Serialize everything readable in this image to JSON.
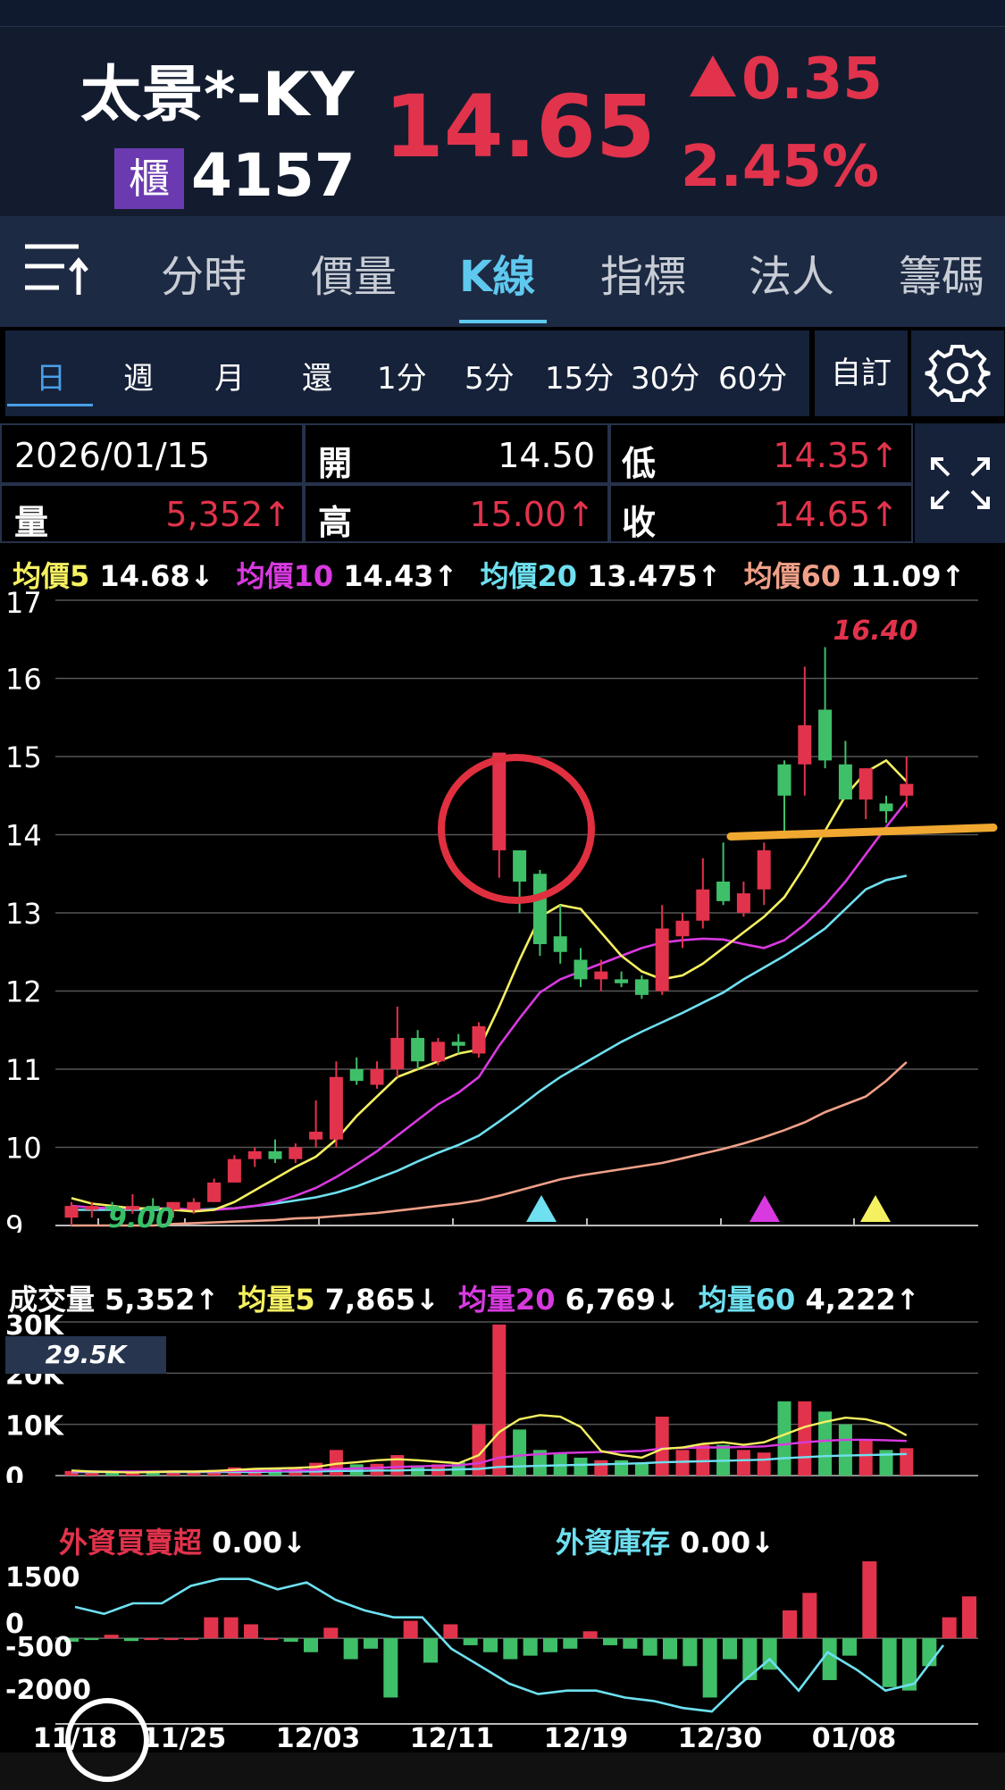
{
  "header": {
    "stock_name": "太景*-KY",
    "market_badge": "櫃",
    "stock_code": "4157",
    "price": "14.65",
    "change": "0.35",
    "change_pct": "2.45%"
  },
  "tabs": [
    {
      "label": "分時"
    },
    {
      "label": "價量"
    },
    {
      "label": "K線"
    },
    {
      "label": "指標"
    },
    {
      "label": "法人"
    },
    {
      "label": "籌碼"
    }
  ],
  "periods": [
    "日",
    "週",
    "月",
    "還",
    "1分",
    "5分",
    "15分",
    "30分",
    "60分"
  ],
  "custom_label": "自訂",
  "quote": {
    "date": "2026/01/15",
    "open_label": "開",
    "open": "14.50",
    "low_label": "低",
    "low": "14.35↑",
    "vol_label": "量",
    "vol": "5,352↑",
    "high_label": "高",
    "high": "15.00↑",
    "close_label": "收",
    "close": "14.65↑"
  },
  "ma_legend": {
    "ma5_label": "均價5",
    "ma5": "14.68↓",
    "ma10_label": "均價10",
    "ma10": "14.43↑",
    "ma20_label": "均價20",
    "ma20": "13.475↑",
    "ma60_label": "均價60",
    "ma60": "11.09↑"
  },
  "vol_legend": {
    "vol_label": "成交量",
    "vol": "5,352↑",
    "mv5_label": "均量5",
    "mv5": "7,865↓",
    "mv20_label": "均量20",
    "mv20": "6,769↓",
    "mv60_label": "均量60",
    "mv60": "4,222↑"
  },
  "vol_max_label": "29.5K",
  "inst_legend": {
    "foreign_label": "外資買賣超",
    "foreign": "0.00↓",
    "holding_label": "外資庫存",
    "holding": "0.00↓"
  },
  "colors": {
    "up": "#e2334c",
    "down": "#3fbf68",
    "ma5": "#f5f060",
    "ma10": "#d83ae0",
    "ma20": "#6ee0f0",
    "ma60": "#f0a088",
    "support_line": "#f0a830",
    "circle": "#e03040"
  },
  "chart_data": {
    "type": "candlestick",
    "price_axis": {
      "ticks": [
        "17",
        "16",
        "15",
        "14",
        "13",
        "12",
        "11",
        "10",
        "9"
      ],
      "ylim": [
        9,
        17
      ]
    },
    "x_ticks": [
      "11/18",
      "11/25",
      "12/03",
      "12/11",
      "12/19",
      "12/30",
      "01/08"
    ],
    "max_label": "16.40",
    "min_label": "9.00",
    "support_level": 14.0,
    "candles": [
      {
        "o": 9.1,
        "h": 9.3,
        "l": 9.0,
        "c": 9.25
      },
      {
        "o": 9.2,
        "h": 9.3,
        "l": 9.1,
        "c": 9.25
      },
      {
        "o": 9.25,
        "h": 9.3,
        "l": 9.15,
        "c": 9.2
      },
      {
        "o": 9.2,
        "h": 9.4,
        "l": 9.15,
        "c": 9.25
      },
      {
        "o": 9.25,
        "h": 9.35,
        "l": 9.15,
        "c": 9.2
      },
      {
        "o": 9.2,
        "h": 9.3,
        "l": 9.1,
        "c": 9.3
      },
      {
        "o": 9.2,
        "h": 9.35,
        "l": 9.15,
        "c": 9.3
      },
      {
        "o": 9.3,
        "h": 9.6,
        "l": 9.3,
        "c": 9.55
      },
      {
        "o": 9.55,
        "h": 9.9,
        "l": 9.55,
        "c": 9.85
      },
      {
        "o": 9.85,
        "h": 10.0,
        "l": 9.75,
        "c": 9.95
      },
      {
        "o": 9.95,
        "h": 10.1,
        "l": 9.8,
        "c": 9.85
      },
      {
        "o": 9.85,
        "h": 10.05,
        "l": 9.8,
        "c": 10.0
      },
      {
        "o": 10.1,
        "h": 10.6,
        "l": 10.0,
        "c": 10.2
      },
      {
        "o": 10.1,
        "h": 11.1,
        "l": 10.0,
        "c": 10.9
      },
      {
        "o": 11.0,
        "h": 11.15,
        "l": 10.8,
        "c": 10.85
      },
      {
        "o": 10.8,
        "h": 11.1,
        "l": 10.75,
        "c": 11.0
      },
      {
        "o": 11.0,
        "h": 11.8,
        "l": 10.9,
        "c": 11.4
      },
      {
        "o": 11.4,
        "h": 11.5,
        "l": 11.0,
        "c": 11.1
      },
      {
        "o": 11.1,
        "h": 11.4,
        "l": 11.05,
        "c": 11.35
      },
      {
        "o": 11.35,
        "h": 11.45,
        "l": 11.2,
        "c": 11.3
      },
      {
        "o": 11.2,
        "h": 11.6,
        "l": 11.15,
        "c": 11.55
      },
      {
        "o": 13.8,
        "h": 15.05,
        "l": 13.45,
        "c": 15.05
      },
      {
        "o": 13.8,
        "h": 13.8,
        "l": 13.0,
        "c": 13.4
      },
      {
        "o": 13.5,
        "h": 13.55,
        "l": 12.45,
        "c": 12.6
      },
      {
        "o": 12.7,
        "h": 13.1,
        "l": 12.35,
        "c": 12.5
      },
      {
        "o": 12.4,
        "h": 12.55,
        "l": 12.05,
        "c": 12.15
      },
      {
        "o": 12.15,
        "h": 12.4,
        "l": 12.0,
        "c": 12.25
      },
      {
        "o": 12.15,
        "h": 12.25,
        "l": 12.05,
        "c": 12.1
      },
      {
        "o": 12.15,
        "h": 12.2,
        "l": 11.9,
        "c": 11.95
      },
      {
        "o": 12.0,
        "h": 13.1,
        "l": 11.95,
        "c": 12.8
      },
      {
        "o": 12.7,
        "h": 13.0,
        "l": 12.55,
        "c": 12.9
      },
      {
        "o": 12.9,
        "h": 13.7,
        "l": 12.8,
        "c": 13.3
      },
      {
        "o": 13.4,
        "h": 13.9,
        "l": 13.1,
        "c": 13.15
      },
      {
        "o": 13.0,
        "h": 13.4,
        "l": 12.95,
        "c": 13.25
      },
      {
        "o": 13.3,
        "h": 13.9,
        "l": 13.1,
        "c": 13.8
      },
      {
        "o": 14.9,
        "h": 14.95,
        "l": 13.95,
        "c": 14.5
      },
      {
        "o": 14.9,
        "h": 16.15,
        "l": 14.5,
        "c": 15.4
      },
      {
        "o": 15.6,
        "h": 16.4,
        "l": 14.85,
        "c": 14.95
      },
      {
        "o": 14.9,
        "h": 15.2,
        "l": 14.55,
        "c": 14.45
      },
      {
        "o": 14.45,
        "h": 14.85,
        "l": 14.2,
        "c": 14.85
      },
      {
        "o": 14.4,
        "h": 14.5,
        "l": 14.15,
        "c": 14.3
      },
      {
        "o": 14.5,
        "h": 15.0,
        "l": 14.35,
        "c": 14.65
      }
    ],
    "ma5": [
      9.35,
      9.28,
      9.25,
      9.22,
      9.22,
      9.2,
      9.18,
      9.2,
      9.3,
      9.45,
      9.6,
      9.75,
      9.88,
      10.1,
      10.4,
      10.65,
      10.9,
      11.0,
      11.1,
      11.2,
      11.25,
      11.8,
      12.4,
      12.95,
      13.1,
      13.05,
      12.75,
      12.45,
      12.25,
      12.15,
      12.2,
      12.35,
      12.55,
      12.75,
      12.95,
      13.2,
      13.6,
      14.05,
      14.5,
      14.8,
      14.95,
      14.68
    ],
    "ma10": [
      9.25,
      9.23,
      9.22,
      9.22,
      9.22,
      9.22,
      9.2,
      9.2,
      9.22,
      9.25,
      9.3,
      9.38,
      9.48,
      9.62,
      9.78,
      9.95,
      10.15,
      10.35,
      10.55,
      10.7,
      10.9,
      11.3,
      11.65,
      11.98,
      12.15,
      12.25,
      12.35,
      12.45,
      12.55,
      12.62,
      12.65,
      12.67,
      12.66,
      12.6,
      12.55,
      12.65,
      12.85,
      13.1,
      13.4,
      13.75,
      14.1,
      14.43
    ],
    "ma20": [
      9.2,
      9.2,
      9.2,
      9.2,
      9.2,
      9.2,
      9.2,
      9.21,
      9.22,
      9.25,
      9.28,
      9.32,
      9.36,
      9.42,
      9.5,
      9.6,
      9.7,
      9.82,
      9.93,
      10.03,
      10.15,
      10.33,
      10.52,
      10.72,
      10.9,
      11.05,
      11.2,
      11.35,
      11.48,
      11.6,
      11.72,
      11.85,
      11.98,
      12.15,
      12.3,
      12.45,
      12.62,
      12.8,
      13.05,
      13.3,
      13.42,
      13.475
    ],
    "ma60": [
      9.0,
      9.0,
      9.0,
      9.0,
      9.0,
      9.02,
      9.03,
      9.04,
      9.05,
      9.06,
      9.07,
      9.09,
      9.1,
      9.12,
      9.14,
      9.16,
      9.19,
      9.22,
      9.25,
      9.28,
      9.32,
      9.38,
      9.45,
      9.52,
      9.59,
      9.64,
      9.68,
      9.72,
      9.76,
      9.8,
      9.86,
      9.92,
      9.98,
      10.05,
      10.13,
      10.22,
      10.32,
      10.45,
      10.55,
      10.65,
      10.85,
      11.09
    ],
    "volume": {
      "ticks": [
        "30K",
        "20K",
        "10K",
        "0"
      ],
      "ylim": [
        0,
        30000
      ],
      "values": [
        900,
        700,
        500,
        600,
        800,
        900,
        700,
        1100,
        1600,
        1400,
        1300,
        1500,
        2500,
        5000,
        2200,
        2300,
        4000,
        2000,
        2200,
        2600,
        10000,
        29500,
        9000,
        5000,
        4500,
        3500,
        3000,
        3000,
        2500,
        11500,
        5000,
        6000,
        6000,
        5000,
        4500,
        14500,
        14500,
        12500,
        10000,
        7000,
        5000,
        5352
      ],
      "ma5": [
        1000,
        800,
        700,
        600,
        700,
        800,
        800,
        900,
        1100,
        1300,
        1400,
        1500,
        1700,
        2300,
        2600,
        3000,
        3200,
        3000,
        2700,
        2400,
        4000,
        8500,
        11000,
        11800,
        11500,
        9500,
        4800,
        4000,
        3500,
        5200,
        5500,
        6200,
        6500,
        6000,
        6500,
        8000,
        9500,
        10500,
        11300,
        11000,
        10000,
        7865
      ],
      "ma20": [
        800,
        800,
        800,
        800,
        800,
        800,
        800,
        800,
        900,
        900,
        900,
        1000,
        1100,
        1300,
        1400,
        1500,
        1700,
        1800,
        1900,
        2000,
        2400,
        3500,
        3900,
        4200,
        4400,
        4500,
        4600,
        4700,
        4800,
        5300,
        5400,
        5500,
        5500,
        5600,
        5700,
        6100,
        6500,
        6800,
        7000,
        7000,
        6900,
        6769
      ],
      "ma60": [
        700,
        700,
        700,
        700,
        700,
        700,
        700,
        700,
        700,
        700,
        800,
        800,
        800,
        900,
        900,
        1000,
        1000,
        1100,
        1100,
        1200,
        1300,
        1700,
        1800,
        1900,
        2000,
        2100,
        2200,
        2300,
        2400,
        2600,
        2700,
        2800,
        2900,
        3000,
        3100,
        3400,
        3600,
        3800,
        3900,
        4000,
        4100,
        4222
      ]
    },
    "foreign": {
      "ticks": [
        "1500",
        "0",
        "-500",
        "-2000"
      ],
      "ylim": [
        -2200,
        2000
      ],
      "bars": [
        -100,
        -50,
        100,
        -80,
        0,
        0,
        0,
        600,
        600,
        400,
        0,
        -100,
        -400,
        300,
        -600,
        -300,
        -1700,
        500,
        -700,
        400,
        -200,
        -400,
        -600,
        -500,
        -400,
        -300,
        200,
        -200,
        -300,
        -500,
        -600,
        -800,
        -1700,
        -600,
        -1200,
        -900,
        800,
        1300,
        -1200,
        -500,
        2400,
        -1400,
        -1500,
        -800,
        600,
        1200
      ],
      "line": [
        900,
        700,
        1000,
        1000,
        1500,
        1700,
        1700,
        1400,
        1600,
        1100,
        800,
        600,
        600,
        -300,
        -800,
        -1300,
        -1600,
        -1500,
        -1500,
        -1700,
        -1800,
        -2000,
        -2100,
        -1300,
        -600,
        -1500,
        -400,
        -900,
        -1500,
        -1300,
        -200
      ]
    }
  }
}
